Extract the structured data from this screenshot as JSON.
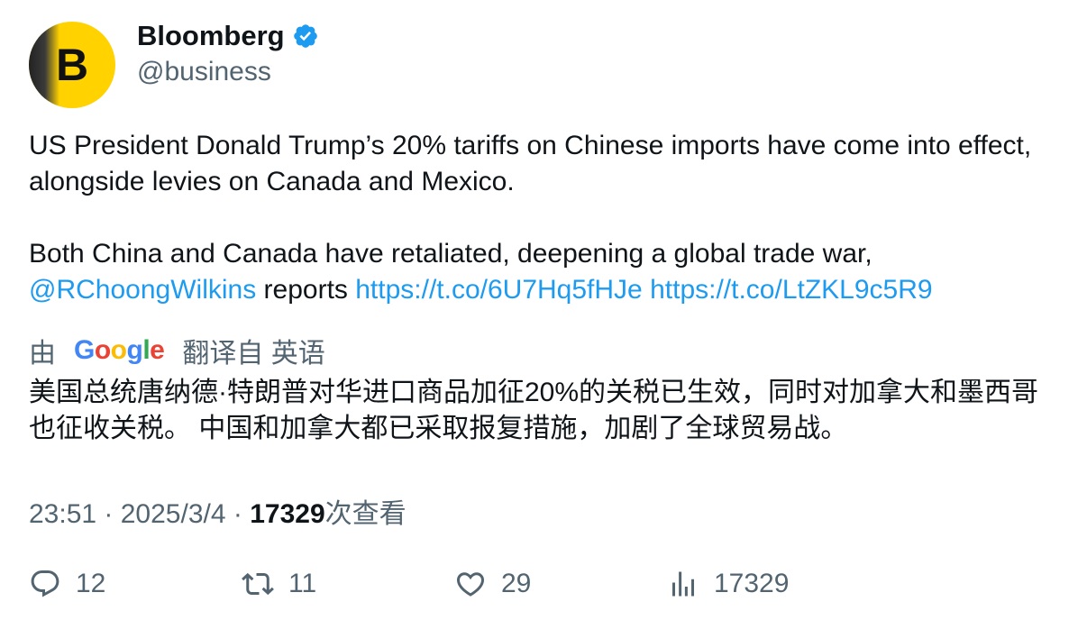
{
  "author": {
    "avatar_letter": "B",
    "display_name": "Bloomberg",
    "handle": "@business",
    "verified": true,
    "brand_color": "#ffd200"
  },
  "tweet": {
    "paragraph1": "US President Donald Trump’s 20% tariffs on Chinese imports have come into effect, alongside levies on Canada and Mexico.",
    "paragraph2_text": "Both China and Canada have retaliated, deepening a global trade war,",
    "mention": "@RChoongWilkins",
    "reports_word": " reports ",
    "link1": "https://t.co/6U7Hq5fHJe",
    "link2": "https://t.co/LtZKL9c5R9"
  },
  "translation": {
    "by_label": "由",
    "provider": "Google",
    "from_label": "翻译自 英语",
    "text": "美国总统唐纳德·特朗普对华进口商品加征20%的关税已生效，同时对加拿大和墨西哥也征收关税。 中国和加拿大都已采取报复措施，加剧了全球贸易战。"
  },
  "meta": {
    "time": "23:51",
    "separator": " · ",
    "date": "2025/3/4",
    "views_count": "17329",
    "views_label": "次查看"
  },
  "actions": {
    "replies": "12",
    "retweets": "11",
    "likes": "29",
    "views": "17329"
  },
  "colors": {
    "link": "#1d9bf0",
    "secondary_text": "#536471",
    "primary_text": "#0f1419"
  }
}
